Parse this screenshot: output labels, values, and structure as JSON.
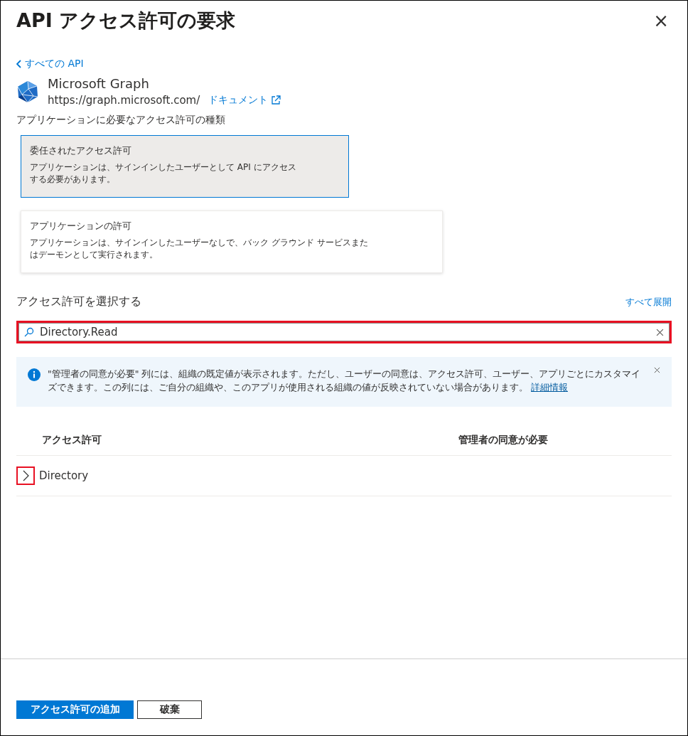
{
  "panel": {
    "title": "API アクセス許可の要求",
    "close": "×"
  },
  "back_link": "すべての API",
  "api": {
    "name": "Microsoft Graph",
    "url": "https://graph.microsoft.com/",
    "doc_link": "ドキュメント"
  },
  "permission_type_label": "アプリケーションに必要なアクセス許可の種類",
  "permission_types": [
    {
      "title": "委任されたアクセス許可",
      "description": "アプリケーションは、サインインしたユーザーとして API にアクセスする必要があります。",
      "selected": true
    },
    {
      "title": "アプリケーションの許可",
      "description": "アプリケーションは、サインインしたユーザーなしで、バック グラウンド サービスまたはデーモンとして実行されます。",
      "selected": false
    }
  ],
  "select_label": "アクセス許可を選択する",
  "expand_all": "すべて展開",
  "search": {
    "value": "Directory.Read",
    "highlighted": true
  },
  "info": {
    "text": "\"管理者の同意が必要\" 列には、組織の既定値が表示されます。ただし、ユーザーの同意は、アクセス許可、ユーザー、アプリごとにカスタマイズできます。この列には、ご自分の組織や、このアプリが使用される組織の値が反映されていない場合があります。",
    "link": "詳細情報"
  },
  "table": {
    "columns": [
      "アクセス許可",
      "管理者の同意が必要"
    ],
    "rows": [
      {
        "name": "Directory",
        "expanded": false,
        "highlighted": true
      }
    ]
  },
  "buttons": [
    {
      "label": "アクセス許可の追加",
      "kind": "primary"
    },
    {
      "label": "破棄",
      "kind": "secondary"
    }
  ]
}
